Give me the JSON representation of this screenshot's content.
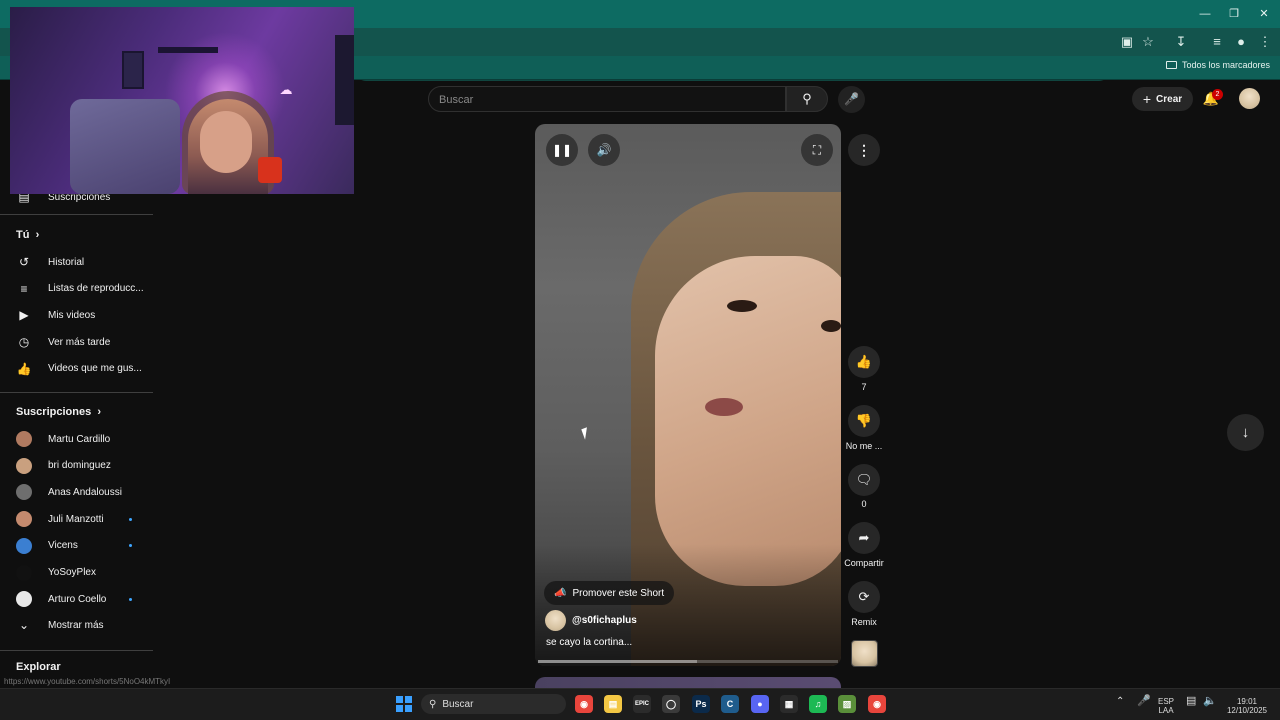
{
  "browser": {
    "bookmarks_folder": "Todos los marcadores",
    "minimize_icon": "minimize-icon",
    "restore_icon": "restore-icon",
    "close_icon": "close-icon"
  },
  "header": {
    "search_placeholder": "Buscar",
    "create_label": "Crear",
    "notification_count": "2"
  },
  "sidebar": {
    "partial_item": "Suscripciones",
    "you_section": "Tú",
    "you_items": [
      {
        "label": "Historial",
        "icon": "history-icon"
      },
      {
        "label": "Listas de reproducc...",
        "icon": "playlist-icon"
      },
      {
        "label": "Mis videos",
        "icon": "my-videos-icon"
      },
      {
        "label": "Ver más tarde",
        "icon": "clock-icon"
      },
      {
        "label": "Videos que me gus...",
        "icon": "thumbs-up-icon"
      }
    ],
    "subs_section": "Suscripciones",
    "subscriptions": [
      {
        "label": "Martu Cardillo",
        "new": false,
        "color": "#b07a60"
      },
      {
        "label": "bri dominguez",
        "new": false,
        "color": "#c9a07f"
      },
      {
        "label": "Anas Andaloussi",
        "new": false,
        "color": "#6e6e6e"
      },
      {
        "label": "Juli Manzotti",
        "new": true,
        "color": "#c48a6e"
      },
      {
        "label": "Vicens",
        "new": true,
        "color": "#3b7fd1"
      },
      {
        "label": "YoSoyPlex",
        "new": false,
        "color": "#111111"
      },
      {
        "label": "Arturo Coello",
        "new": true,
        "color": "#e8e8e8"
      }
    ],
    "show_more": "Mostrar más",
    "explore_section": "Explorar",
    "status_url": "https://www.youtube.com/shorts/5NoO4kMTkyI"
  },
  "short": {
    "promote_label": "Promover este Short",
    "channel": "@s0fichaplus",
    "caption": "se cayo la cortina...",
    "progress": 0.53,
    "actions": {
      "likes": "7",
      "dislike_label": "No me ...",
      "comments": "0",
      "share_label": "Compartir",
      "remix_label": "Remix"
    }
  },
  "taskbar": {
    "search_label": "Buscar",
    "lang_line1": "ESP",
    "lang_line2": "LAA",
    "time": "19:01",
    "date": "12/10/2025",
    "apps": [
      "chrome-icon",
      "file-explorer-icon",
      "epic-games-icon",
      "obs-icon",
      "photoshop-icon",
      "ccleaner-icon",
      "discord-icon",
      "capcut-icon",
      "spotify-icon",
      "minecraft-icon",
      "chrome-active-icon"
    ]
  },
  "colors": {
    "titlebar": "#0d6b62",
    "background": "#0f0f0f",
    "accent_dot": "#3ea6ff",
    "badge": "#cc0000"
  }
}
